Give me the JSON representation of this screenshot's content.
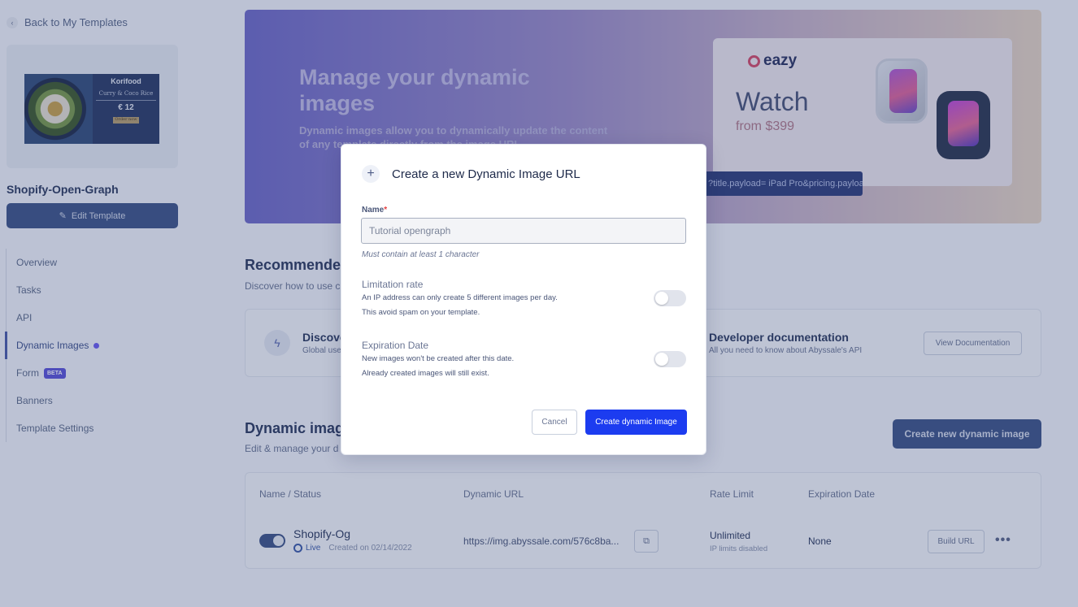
{
  "sidebar": {
    "back_label": "Back to My Templates",
    "thumbnail": {
      "title": "Korifood",
      "subtitle": "Curry & Coco Rice",
      "price": "€ 12",
      "badge": "Order now"
    },
    "template_name": "Shopify-Open-Graph",
    "edit_label": "Edit Template",
    "nav": [
      {
        "label": "Overview"
      },
      {
        "label": "Tasks"
      },
      {
        "label": "API"
      },
      {
        "label": "Dynamic Images",
        "active": true
      },
      {
        "label": "Form",
        "badge": "BETA"
      },
      {
        "label": "Banners"
      },
      {
        "label": "Template Settings"
      }
    ]
  },
  "banner": {
    "title": "Manage your dynamic images",
    "description": "Dynamic images allow you to dynamically update the content of any template directly from the image URL.",
    "promo": {
      "brand": "eazy",
      "headline": "Watch",
      "price": "from $399",
      "payload": "?title.payload= iPad Pro&pricing.payload"
    }
  },
  "recommended": {
    "title": "Recommended",
    "subtitle": "Discover how to use c",
    "card1": {
      "title": "Discove",
      "subtitle": "Global use"
    },
    "card2": {
      "title": "Developer documentation",
      "subtitle": "All you need to know about Abyssale's API",
      "button": "View Documentation"
    }
  },
  "dynamic_images": {
    "title": "Dynamic imag",
    "subtitle": "Edit & manage your d",
    "create_button": "Create new dynamic image",
    "columns": [
      "Name / Status",
      "Dynamic URL",
      "Rate Limit",
      "Expiration Date"
    ],
    "rows": [
      {
        "name": "Shopify-Og",
        "status": "Live",
        "created": "Created on 02/14/2022",
        "url": "https://img.abyssale.com/576c8ba...",
        "rate_limit": "Unlimited",
        "rate_limit_note": "IP limits disabled",
        "expiration": "None",
        "build_button": "Build URL"
      }
    ]
  },
  "modal": {
    "title": "Create a new Dynamic Image URL",
    "name_label": "Name",
    "name_required": "*",
    "name_value": "Tutorial opengraph",
    "name_hint": "Must contain at least 1 character",
    "limitation": {
      "title": "Limitation rate",
      "line1": "An IP address can only create 5 different images per day.",
      "line2": "This avoid spam on your template.",
      "enabled": false
    },
    "expiration": {
      "title": "Expiration Date",
      "line1": "New images won't be created after this date.",
      "line2": "Already created images will still exist.",
      "enabled": false
    },
    "cancel_label": "Cancel",
    "create_label": "Create dynamic Image"
  },
  "colors": {
    "primary": "#1c3cf0",
    "sidebar_button": "#3d5487",
    "active_dot": "#6b5cf0"
  }
}
